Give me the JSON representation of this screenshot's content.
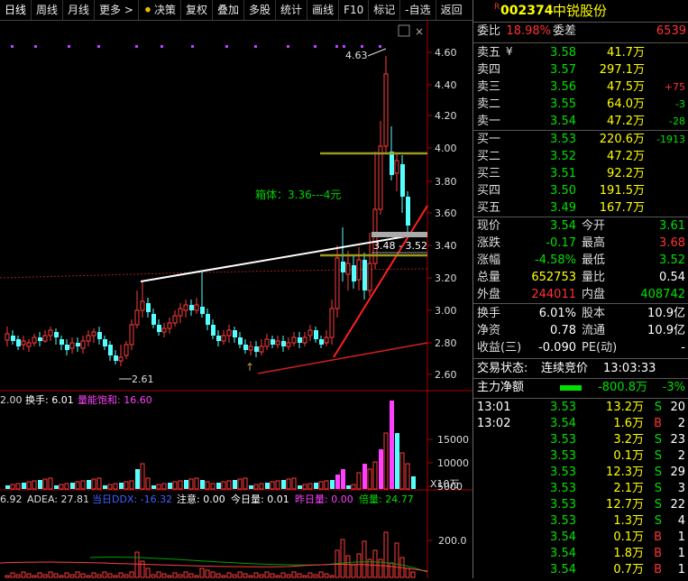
{
  "toolbar": {
    "items": [
      "日线",
      "周线",
      "月线",
      "更多 >",
      "决策",
      "复权",
      "叠加",
      "多股",
      "统计",
      "画线",
      "F10",
      "标记",
      "-自选",
      "返回"
    ],
    "icon": "lightbulb-icon"
  },
  "chart": {
    "price_ticks": [
      "4.60",
      "4.40",
      "4.20",
      "4.00",
      "3.80",
      "3.60",
      "3.40",
      "3.20",
      "3.00",
      "2.80",
      "2.60"
    ],
    "high_label": "4.63",
    "low_label": "2.61",
    "box_label": "箱体：3.36---4元",
    "range_label": "3.48 - 3.52",
    "vol_info": {
      "prefix": "2.00",
      "turnover_label": "换手: 6.01",
      "satur_label": "量能饱和: 16.60"
    },
    "vol_ticks": [
      "15000",
      "10000",
      "5000"
    ],
    "vol_unit": "X10万",
    "ddx_info": {
      "a": "6.92",
      "adea": "ADEA: 27.81",
      "ddx": "当日DDX: -16.32",
      "zhuyi": "注意: 0.00",
      "jr": "今日量: 0.01",
      "zr": "昨日量: 0.00",
      "bl": "倍量: 24.77"
    },
    "ddx_tick": "200.0"
  },
  "panel": {
    "badge": "R",
    "code": "002374",
    "name": "中锐股份",
    "weibi": {
      "label": "委比",
      "value": "18.98%",
      "label2": "委差",
      "value2": "6539"
    },
    "sells": [
      {
        "label": "卖五",
        "price": "3.58",
        "vol": "41.7万",
        "chg": ""
      },
      {
        "label": "卖四",
        "price": "3.57",
        "vol": "297.1万",
        "chg": ""
      },
      {
        "label": "卖三",
        "price": "3.56",
        "vol": "47.5万",
        "chg": "+75"
      },
      {
        "label": "卖二",
        "price": "3.55",
        "vol": "64.0万",
        "chg": "-3"
      },
      {
        "label": "卖一",
        "price": "3.54",
        "vol": "47.2万",
        "chg": "-28"
      }
    ],
    "sell5_mark": "¥",
    "buys": [
      {
        "label": "买一",
        "price": "3.53",
        "vol": "220.6万",
        "chg": "-1913"
      },
      {
        "label": "买二",
        "price": "3.52",
        "vol": "47.2万",
        "chg": ""
      },
      {
        "label": "买三",
        "price": "3.51",
        "vol": "92.2万",
        "chg": ""
      },
      {
        "label": "买四",
        "price": "3.50",
        "vol": "191.5万",
        "chg": ""
      },
      {
        "label": "买五",
        "price": "3.49",
        "vol": "167.7万",
        "chg": ""
      }
    ],
    "quote": [
      {
        "l1": "现价",
        "v1": "3.54",
        "l2": "今开",
        "v2": "3.61"
      },
      {
        "l1": "涨跌",
        "v1": "-0.17",
        "l2": "最高",
        "v2": "3.68"
      },
      {
        "l1": "涨幅",
        "v1": "-4.58%",
        "l2": "最低",
        "v2": "3.52"
      },
      {
        "l1": "总量",
        "v1": "652753",
        "l2": "量比",
        "v2": "0.54"
      },
      {
        "l1": "外盘",
        "v1": "244011",
        "l2": "内盘",
        "v2": "408742"
      }
    ],
    "fund": [
      {
        "l1": "换手",
        "v1": "6.01%",
        "l2": "股本",
        "v2": "10.9亿"
      },
      {
        "l1": "净资",
        "v1": "0.78",
        "l2": "流通",
        "v2": "10.9亿"
      },
      {
        "l1": "收益(三)",
        "v1": "-0.090",
        "l2": "PE(动)",
        "v2": "-"
      }
    ],
    "status": {
      "label": "交易状态:",
      "value": "连续竞价",
      "time": "13:03:33"
    },
    "main_flow": {
      "label": "主力净额",
      "value": "-800.8万",
      "pct": "-3%"
    },
    "ticks": [
      {
        "time": "13:01",
        "price": "3.53",
        "vol": "13.2万",
        "side": "S",
        "n": "20"
      },
      {
        "time": "13:02",
        "price": "3.54",
        "vol": "1.6万",
        "side": "B",
        "n": "2"
      },
      {
        "time": "",
        "price": "3.53",
        "vol": "3.2万",
        "side": "S",
        "n": "23"
      },
      {
        "time": "",
        "price": "3.53",
        "vol": "0.1万",
        "side": "S",
        "n": "2"
      },
      {
        "time": "",
        "price": "3.53",
        "vol": "12.3万",
        "side": "S",
        "n": "29"
      },
      {
        "time": "",
        "price": "3.53",
        "vol": "2.1万",
        "side": "S",
        "n": "3"
      },
      {
        "time": "",
        "price": "3.53",
        "vol": "12.7万",
        "side": "S",
        "n": "22"
      },
      {
        "time": "",
        "price": "3.53",
        "vol": "1.3万",
        "side": "S",
        "n": "4"
      },
      {
        "time": "",
        "price": "3.54",
        "vol": "0.1万",
        "side": "B",
        "n": "1"
      },
      {
        "time": "",
        "price": "3.54",
        "vol": "1.8万",
        "side": "B",
        "n": "1"
      },
      {
        "time": "",
        "price": "3.54",
        "vol": "0.7万",
        "side": "B",
        "n": "1"
      }
    ]
  }
}
